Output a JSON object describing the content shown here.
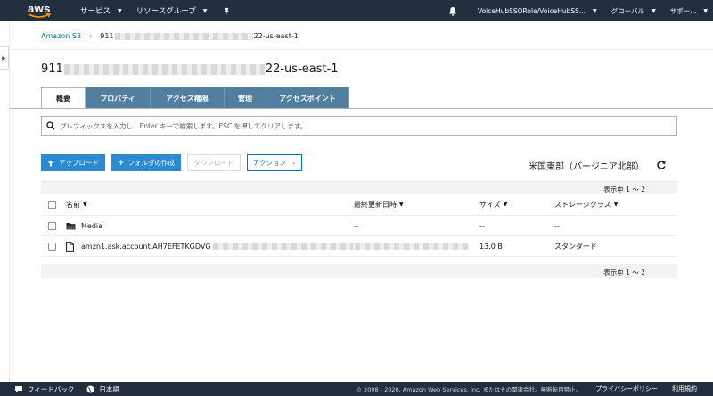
{
  "topnav": {
    "logo": "aws",
    "services_label": "サービス",
    "resource_groups_label": "リソースグループ",
    "role_label": "VoiceHubSSORole/VoiceHubSS...",
    "region_label": "グローバル",
    "support_label": "サポー..."
  },
  "breadcrumb": {
    "root": "Amazon S3",
    "bucket_prefix": "911",
    "bucket_suffix": "22-us-east-1"
  },
  "title": {
    "prefix": "911",
    "suffix": "22-us-east-1"
  },
  "tabs": [
    "概要",
    "プロパティ",
    "アクセス権限",
    "管理",
    "アクセスポイント"
  ],
  "search": {
    "placeholder": "プレフィックスを入力し、Enter キーで検索します。ESC を押してクリアします。"
  },
  "toolbar": {
    "upload": "アップロード",
    "create_folder": "フォルダの作成",
    "download": "ダウンロード",
    "actions": "アクション"
  },
  "region_name": "米国東部（バージニア北部）",
  "pager": "表示中 1 〜 2",
  "table": {
    "columns": [
      "名前",
      "最終更新日時",
      "サイズ",
      "ストレージクラス"
    ],
    "rows": [
      {
        "name": "Media",
        "type": "folder",
        "modified": "--",
        "size": "--",
        "storage": "--"
      },
      {
        "name": "amzn1.ask.account.AH7EFETKGDVG",
        "type": "file",
        "modified": "",
        "size": "13.0 B",
        "storage": "スタンダード"
      }
    ]
  },
  "footer": {
    "feedback": "フィードバック",
    "language": "日本語",
    "copyright": "© 2008 - 2020, Amazon Web Services, Inc. またはその関連会社。無断転用禁止。",
    "privacy": "プライバシーポリシー",
    "terms": "利用規約"
  },
  "colors": {
    "nav_bg": "#232f3e",
    "tab_bg": "#527fa0",
    "primary": "#2c8ad2",
    "link": "#0073bb"
  }
}
